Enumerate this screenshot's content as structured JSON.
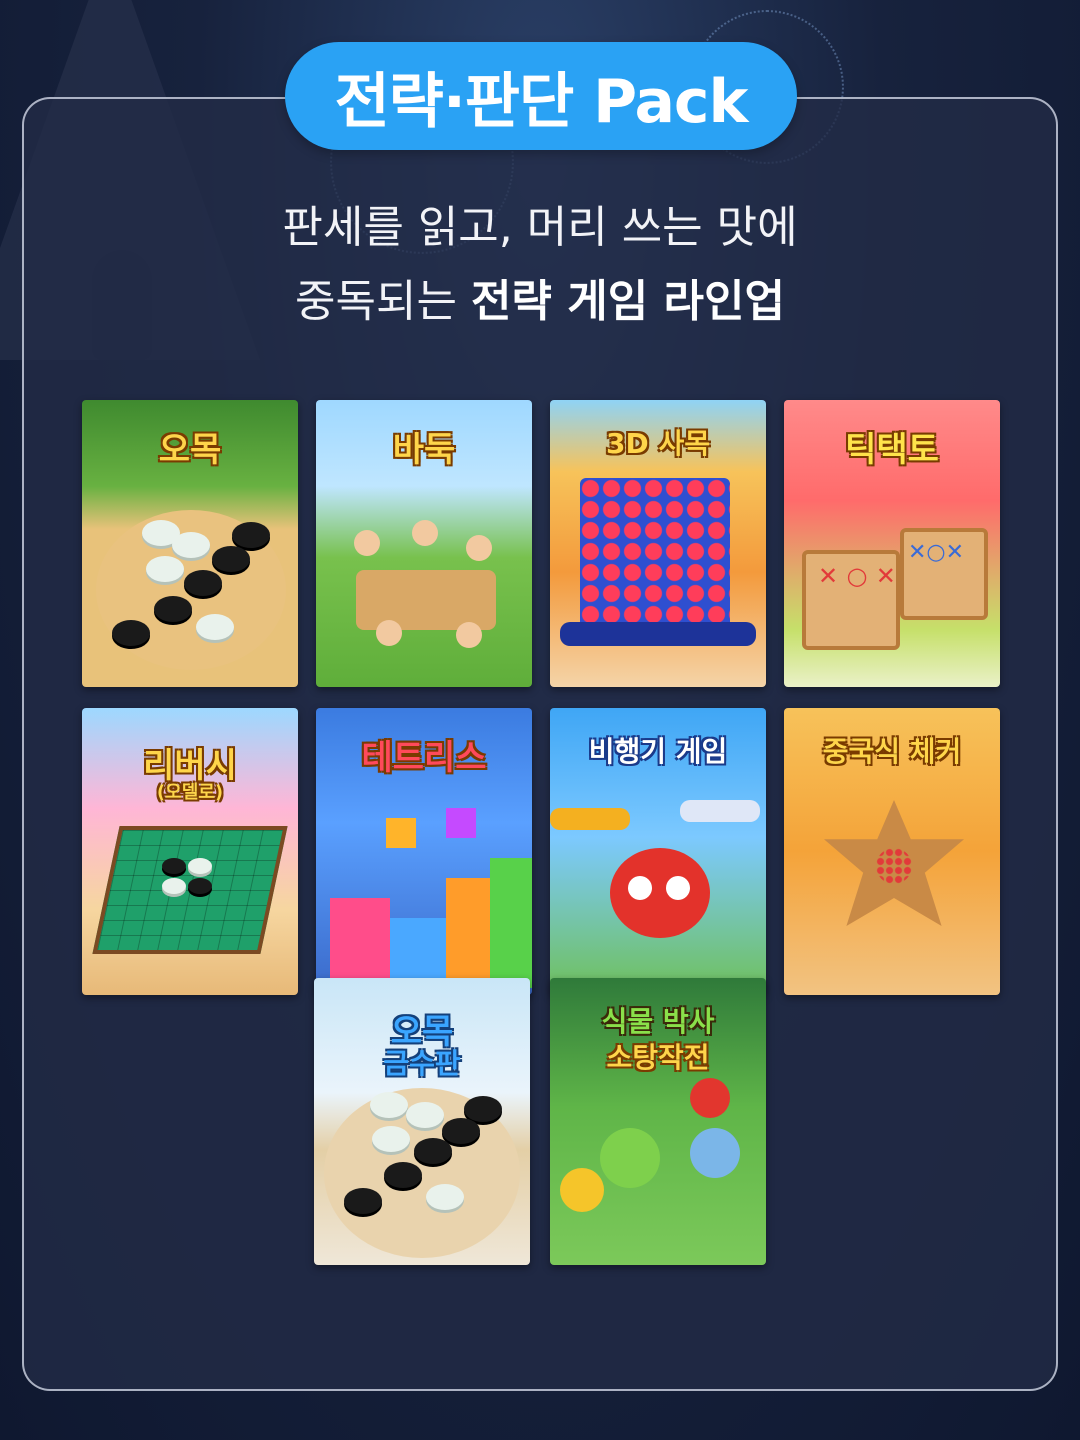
{
  "header": {
    "pill_label": "전략·판단 Pack",
    "subtitle_line1": "판세를 읽고, 머리 쓰는 맛에",
    "subtitle_line2_prefix": "중독되는 ",
    "subtitle_line2_bold": "전략 게임 라인업"
  },
  "games": [
    {
      "title": "오목",
      "icon": "gomoku-board-icon",
      "accent": "#f3b94a"
    },
    {
      "title": "바둑",
      "icon": "baduk-kids-icon",
      "accent": "#6fbf4a"
    },
    {
      "title": "3D 사목",
      "icon": "connect-four-icon",
      "accent": "#2f4fd0"
    },
    {
      "title": "틱택토",
      "icon": "tic-tac-toe-icon",
      "accent": "#ef5a5a"
    },
    {
      "title": "리버시",
      "subtitle": "(오델로)",
      "icon": "reversi-board-icon",
      "accent": "#2fa36b"
    },
    {
      "title": "테트리스",
      "icon": "tetris-blocks-icon",
      "accent": "#3a7fe0"
    },
    {
      "title": "비행기 게임",
      "icon": "airplane-icon",
      "accent": "#e3322b"
    },
    {
      "title": "중국식 체커",
      "icon": "chinese-checkers-icon",
      "accent": "#f0a33a"
    },
    {
      "title": "오목",
      "subtitle": "금수판",
      "icon": "gomoku-snow-icon",
      "accent": "#e7f1f8"
    },
    {
      "title": "식물 박사",
      "subtitle": "소탕작전",
      "icon": "plant-battle-icon",
      "accent": "#4caa3c"
    }
  ]
}
